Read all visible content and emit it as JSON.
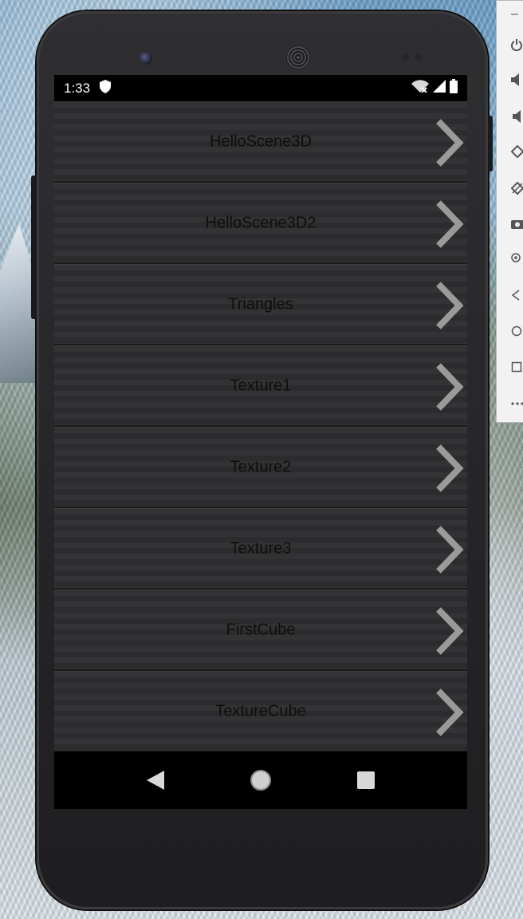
{
  "status_bar": {
    "time": "1:33",
    "icons": [
      "shield-icon",
      "wifi-off-icon",
      "signal-icon",
      "battery-icon"
    ]
  },
  "list": {
    "items": [
      {
        "label": "HelloScene3D"
      },
      {
        "label": "HelloScene3D2"
      },
      {
        "label": "Triangles"
      },
      {
        "label": "Texture1"
      },
      {
        "label": "Texture2"
      },
      {
        "label": "Texture3"
      },
      {
        "label": "FirstCube"
      },
      {
        "label": "TextureCube"
      }
    ],
    "chevron_icon": "chevron-right-icon"
  },
  "nav_bar": {
    "buttons": [
      "back-triangle-icon",
      "home-circle-icon",
      "recents-square-icon"
    ]
  },
  "emulator_toolbar": {
    "minimize": "–",
    "tools": [
      "power-icon",
      "volume-up-icon",
      "volume-down-icon",
      "rotate-left-icon",
      "rotate-right-icon",
      "camera-icon",
      "zoom-icon",
      "back-icon",
      "home-icon",
      "overview-icon",
      "more-icon"
    ]
  },
  "colors": {
    "item_text": "#0e0e0e",
    "chevron": "#9a9a9a",
    "status_bar_bg": "#000000"
  }
}
